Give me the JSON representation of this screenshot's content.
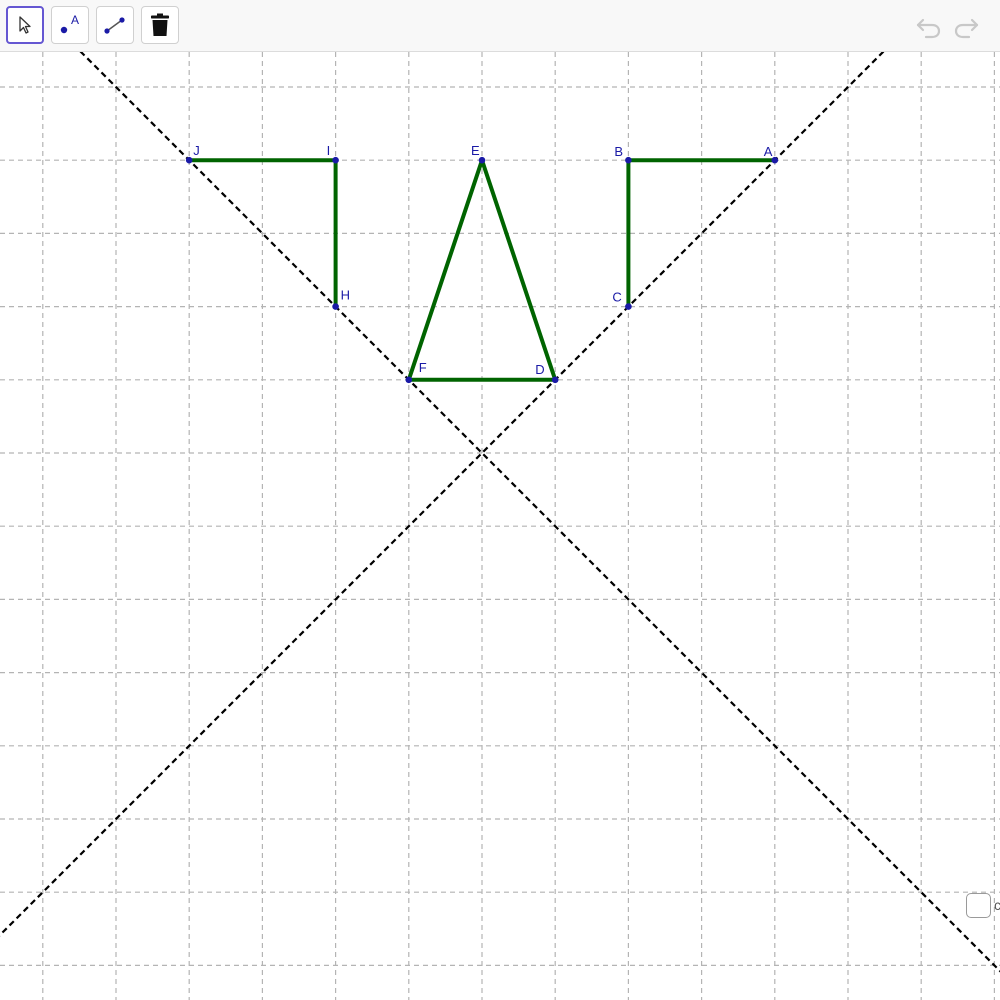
{
  "toolbar": {
    "tools": [
      {
        "icon": "move-arrow-icon",
        "selected": true
      },
      {
        "icon": "point-icon",
        "label": "A",
        "selected": false
      },
      {
        "icon": "segment-icon",
        "selected": false
      },
      {
        "icon": "trash-icon",
        "selected": false
      }
    ],
    "undo_icon": "undo-icon",
    "redo_icon": "redo-icon"
  },
  "graphics": {
    "grid": true,
    "grid_style": "dashed",
    "grid_color": "#b4b4b4",
    "segment_color": "#006400",
    "point_color": "#1a1aa6",
    "line_color": "#000000",
    "points": [
      {
        "name": "A",
        "x": 4,
        "y": 4
      },
      {
        "name": "B",
        "x": 2,
        "y": 4
      },
      {
        "name": "C",
        "x": 2,
        "y": 2
      },
      {
        "name": "D",
        "x": 1,
        "y": 1
      },
      {
        "name": "E",
        "x": 0,
        "y": 4
      },
      {
        "name": "F",
        "x": -1,
        "y": 1
      },
      {
        "name": "H",
        "x": -2,
        "y": 2
      },
      {
        "name": "I",
        "x": -2,
        "y": 4
      },
      {
        "name": "J",
        "x": -4,
        "y": 4
      }
    ],
    "segments": [
      [
        "A",
        "B"
      ],
      [
        "B",
        "C"
      ],
      [
        "E",
        "F"
      ],
      [
        "E",
        "D"
      ],
      [
        "F",
        "D"
      ],
      [
        "J",
        "I"
      ],
      [
        "I",
        "H"
      ]
    ],
    "lines": [
      {
        "equation": "y = x",
        "style": "dashed"
      },
      {
        "equation": "y = -x",
        "style": "dashed"
      }
    ]
  },
  "checkbox": {
    "checked": false,
    "caption": "c"
  }
}
